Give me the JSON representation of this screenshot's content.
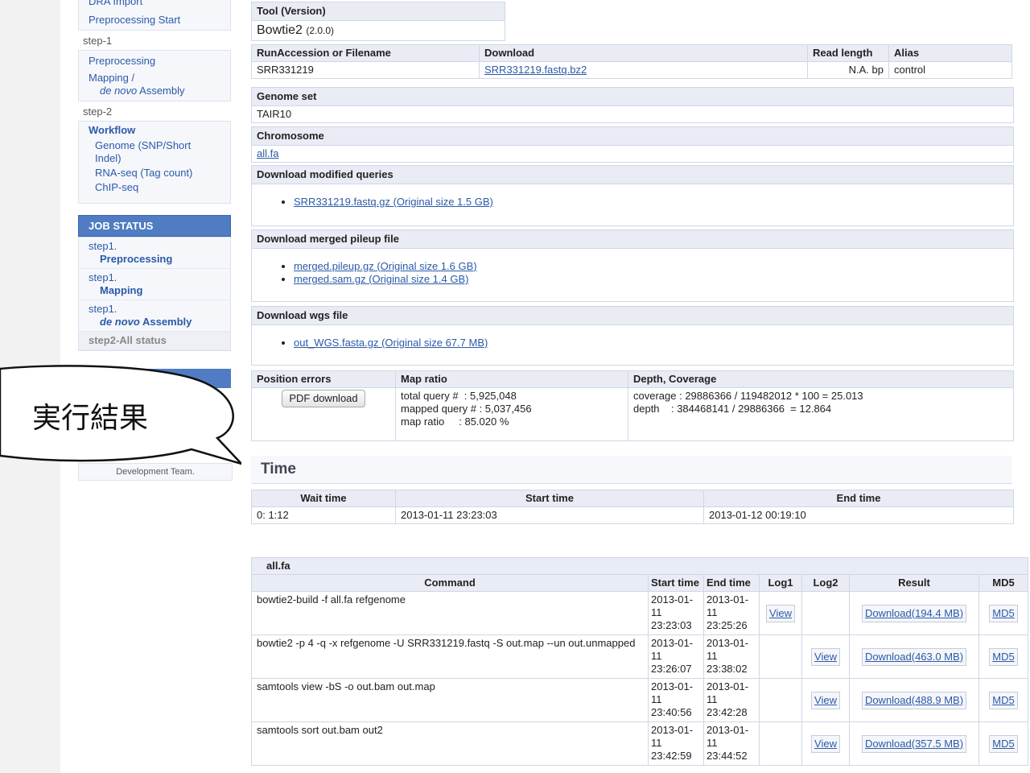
{
  "sidebar": {
    "top_link": "DRA Import",
    "preproc_start": "Preprocessing Start",
    "step1_label": "step-1",
    "preprocessing": "Preprocessing",
    "mapping_line1": "Mapping /",
    "mapping_line2_italic": "de novo",
    "mapping_line2_rest": " Assembly",
    "step2_label": "step-2",
    "workflow": "Workflow",
    "workflow_items": [
      "Genome (SNP/Short Indel)",
      "RNA-seq (Tag count)",
      "ChIP-seq"
    ],
    "job_status_title": "JOB STATUS",
    "job_items": [
      {
        "step": "step1.",
        "name": "Preprocessing"
      },
      {
        "step": "step1.",
        "name": "Mapping"
      },
      {
        "step": "step1.",
        "name_italic": "de novo",
        "name_rest": " Assembly"
      }
    ],
    "all_status": "step2-All status",
    "dev_team": "Development Team."
  },
  "callout_text": "実行結果",
  "tool": {
    "header": "Tool (Version)",
    "name": "Bowtie2",
    "version": "(2.0.0)"
  },
  "run_table": {
    "headers": [
      "RunAccession or Filename",
      "Download",
      "Read length",
      "Alias"
    ],
    "row": {
      "accession": "SRR331219",
      "download": "SRR331219.fastq.bz2",
      "read_length": "N.A. bp",
      "alias": "control"
    }
  },
  "genome_set": {
    "header": "Genome set",
    "value": "TAIR10"
  },
  "chromosome": {
    "header": "Chromosome",
    "value": "all.fa"
  },
  "modified_queries": {
    "header": "Download modified queries",
    "items": [
      "SRR331219.fastq.gz (Original size 1.5 GB)"
    ]
  },
  "merged_pileup": {
    "header": "Download merged pileup file",
    "items": [
      "merged.pileup.gz (Original size 1.6 GB)",
      "merged.sam.gz (Original size 1.4 GB)"
    ]
  },
  "wgs": {
    "header": "Download wgs file",
    "items": [
      "out_WGS.fasta.gz (Original size 67.7 MB)"
    ]
  },
  "stats": {
    "headers": [
      "Position errors",
      "Map ratio",
      "Depth, Coverage"
    ],
    "pdf_button": "PDF download",
    "map_ratio_lines": [
      "total query #  : 5,925,048",
      "mapped query # : 5,037,456",
      "map ratio     : 85.020 %"
    ],
    "depth_lines": [
      "coverage : 29886366 / 119482012 * 100 = 25.013",
      "depth    : 384468141 / 29886366  = 12.864"
    ]
  },
  "time": {
    "title": "Time",
    "headers": [
      "Wait time",
      "Start time",
      "End time"
    ],
    "row": [
      "0: 1:12",
      "2013-01-11 23:23:03",
      "2013-01-12 00:19:10"
    ]
  },
  "commands": {
    "file": "all.fa",
    "headers": [
      "Command",
      "Start time",
      "End time",
      "Log1",
      "Log2",
      "Result",
      "MD5"
    ],
    "rows": [
      {
        "cmd": "bowtie2-build -f all.fa refgenome",
        "start": [
          "2013-01-",
          "11",
          "23:23:03"
        ],
        "end": [
          "2013-01-",
          "11",
          "23:25:26"
        ],
        "log1": "View",
        "log2": "",
        "result": "Download(194.4 MB)",
        "md5": "MD5"
      },
      {
        "cmd": "bowtie2 -p 4 -q -x refgenome -U SRR331219.fastq -S out.map --un out.unmapped",
        "start": [
          "2013-01-",
          "11",
          "23:26:07"
        ],
        "end": [
          "2013-01-",
          "11",
          "23:38:02"
        ],
        "log1": "",
        "log2": "View",
        "result": "Download(463.0 MB)",
        "md5": "MD5"
      },
      {
        "cmd": "samtools view -bS -o out.bam out.map",
        "start": [
          "2013-01-",
          "11",
          "23:40:56"
        ],
        "end": [
          "2013-01-",
          "11",
          "23:42:28"
        ],
        "log1": "",
        "log2": "View",
        "result": "Download(488.9 MB)",
        "md5": "MD5"
      },
      {
        "cmd": "samtools sort out.bam out2",
        "start": [
          "2013-01-",
          "11",
          "23:42:59"
        ],
        "end": [
          "2013-01-",
          "11",
          "23:44:52"
        ],
        "log1": "",
        "log2": "View",
        "result": "Download(357.5 MB)",
        "md5": "MD5"
      }
    ]
  }
}
